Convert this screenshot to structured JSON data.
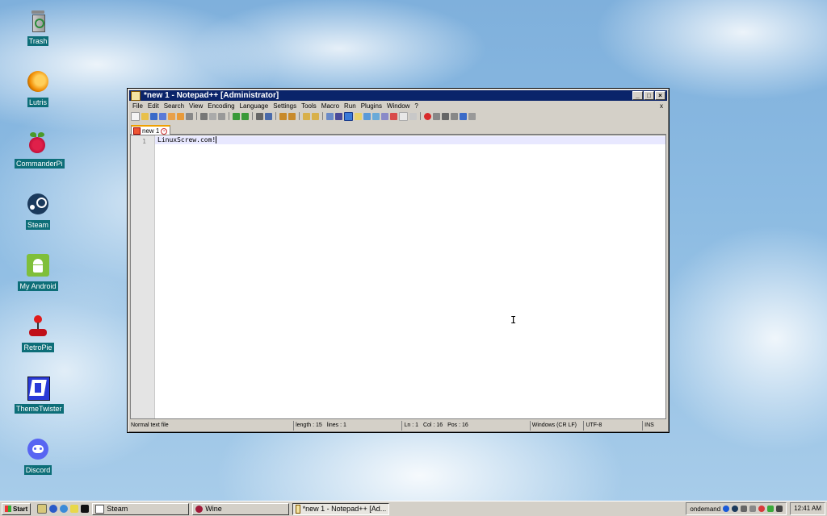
{
  "desktop": {
    "icons": [
      {
        "label": "Trash",
        "icon": "trash-icon"
      },
      {
        "label": "Lutris",
        "icon": "lutris-icon"
      },
      {
        "label": "CommanderPi",
        "icon": "raspberry-pi-icon"
      },
      {
        "label": "Steam",
        "icon": "steam-icon"
      },
      {
        "label": "My Android",
        "icon": "android-icon"
      },
      {
        "label": "RetroPie",
        "icon": "joystick-icon"
      },
      {
        "label": "ThemeTwister",
        "icon": "theme-twister-icon"
      },
      {
        "label": "Discord",
        "icon": "discord-icon"
      }
    ]
  },
  "window": {
    "title": "*new 1 - Notepad++ [Administrator]",
    "controls": {
      "minimize": "_",
      "maximize": "□",
      "close": "×"
    },
    "menu": [
      "File",
      "Edit",
      "Search",
      "View",
      "Encoding",
      "Language",
      "Settings",
      "Tools",
      "Macro",
      "Run",
      "Plugins",
      "Window",
      "?"
    ],
    "menu_close": "x",
    "tab": {
      "label": "new 1"
    },
    "editor": {
      "line_number": "1",
      "text": "LinuxScrew.com!"
    },
    "status": {
      "type": "Normal text file",
      "length": "length : 15",
      "lines": "lines : 1",
      "ln": "Ln : 1",
      "col": "Col : 16",
      "pos": "Pos : 16",
      "eol": "Windows (CR LF)",
      "encoding": "UTF-8",
      "mode": "INS"
    }
  },
  "taskbar": {
    "start_label": "Start",
    "tasks": [
      {
        "label": "Steam",
        "icon": "steam-icon"
      },
      {
        "label": "Wine",
        "icon": "wine-icon"
      },
      {
        "label": "*new 1 - Notepad++ [Ad...",
        "icon": "notepad-icon"
      }
    ],
    "tray_label": "ondemand",
    "clock": "12:41 AM"
  },
  "colors": {
    "titlebar": "#0a246a",
    "desktop_label_bg": "#0d6e78",
    "window_face": "#d4d0c8"
  }
}
